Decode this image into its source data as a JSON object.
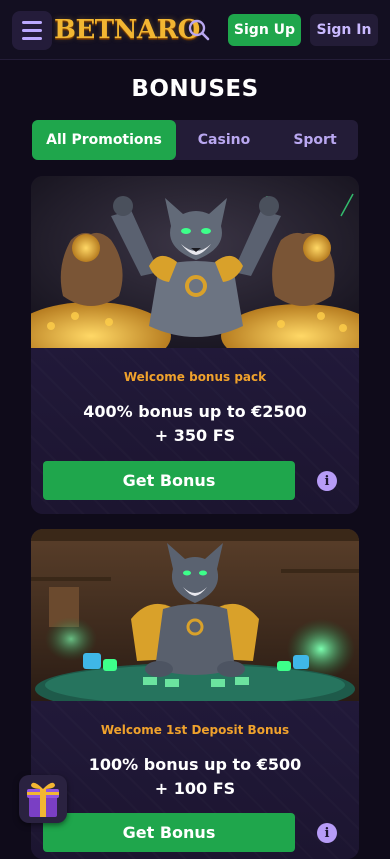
{
  "header": {
    "logo_text": "BETNARO",
    "signup_label": "Sign Up",
    "signin_label": "Sign In",
    "icons": [
      "menu-icon",
      "search-icon"
    ]
  },
  "page": {
    "title": "BONUSES"
  },
  "tabs": [
    {
      "label": "All Promotions",
      "active": true
    },
    {
      "label": "Casino",
      "active": false
    },
    {
      "label": "Sport",
      "active": false
    }
  ],
  "promotions": [
    {
      "tag": "Welcome bonus pack",
      "title_line1": "400% bonus up to €2500",
      "title_line2": "+ 350 FS",
      "cta": "Get Bonus",
      "image_icon": "wolf-with-gold-bags-illustration"
    },
    {
      "tag": "Welcome 1st Deposit Bonus",
      "title_line1": "100% bonus up to €500",
      "title_line2": "+ 100 FS",
      "cta": "Get Bonus",
      "image_icon": "wolf-at-casino-table-illustration"
    }
  ],
  "floating": {
    "icon": "gift-box-icon"
  },
  "colors": {
    "background": "#0f0b1a",
    "accent_green": "#1fa64c",
    "tag_orange": "#f0a22c",
    "tab_purple": "#231c37",
    "logo_gold": "#f2b632"
  }
}
